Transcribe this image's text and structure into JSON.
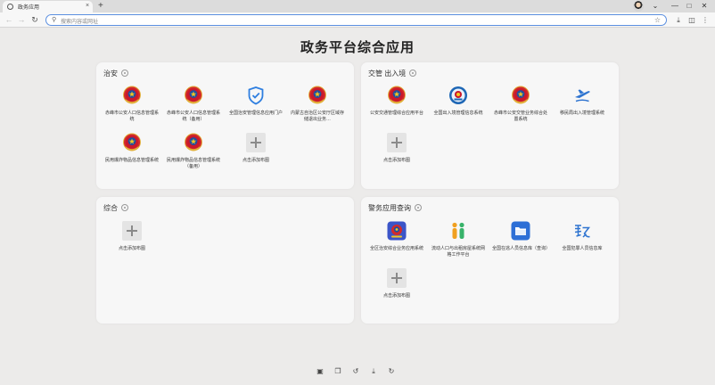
{
  "browser": {
    "tab_title": "政务应用",
    "new_tab": "+",
    "tab_close": "×",
    "window_controls": {
      "menu": "⌄",
      "minimize": "—",
      "maximize": "□",
      "close": "✕"
    },
    "address_placeholder": "搜索内容或网址",
    "icons": [
      "back-icon",
      "forward-icon",
      "reload-icon",
      "search-icon",
      "star-icon",
      "download-icon",
      "sidebar-icon",
      "menu-icon"
    ]
  },
  "page": {
    "title": "政务平台综合应用",
    "add_label": "点击添加布图"
  },
  "cards": {
    "zhian": {
      "title": "治安",
      "apps": [
        {
          "label": "赤峰市公安人口信息管理系统",
          "icon": "police-emblem-icon"
        },
        {
          "label": "赤峰市公安人口信息管理系统（备用）",
          "icon": "police-emblem-icon"
        },
        {
          "label": "全国治安管理信息应用门户",
          "icon": "shield-check-icon"
        },
        {
          "label": "内蒙古自治区公安厅区域存储退出业务…",
          "icon": "police-emblem-icon"
        },
        {
          "label": "民用爆炸物品信息管理系统",
          "icon": "police-emblem-icon"
        },
        {
          "label": "民用爆炸物品信息管理系统（备用）",
          "icon": "police-emblem-icon"
        }
      ]
    },
    "jiaoguan": {
      "title": "交管 出入境",
      "apps": [
        {
          "label": "公安交通管理综合应用平台",
          "icon": "police-emblem-icon"
        },
        {
          "label": "全国出入境管理信息系统",
          "icon": "immigration-badge-icon"
        },
        {
          "label": "赤峰市公安交管业务综合处置系统",
          "icon": "police-emblem-icon"
        },
        {
          "label": "移民局出入境管理系统",
          "icon": "plane-icon"
        }
      ]
    },
    "zonghe": {
      "title": "综合",
      "apps": []
    },
    "jingwu": {
      "title": "警务应用查询",
      "apps": [
        {
          "label": "全区治安综合业务应用系统",
          "icon": "police-app-icon"
        },
        {
          "label": "流动人口与出租房屋系统网格工作平台",
          "icon": "people-icon"
        },
        {
          "label": "全国在逃人员信息库（查询）",
          "icon": "folder-icon"
        },
        {
          "label": "全国犯罪人员信息库",
          "icon": "criminal-record-icon"
        }
      ]
    }
  },
  "bottom_bar": [
    "screenshot-icon",
    "copy-icon",
    "history-icon",
    "download-icon",
    "refresh-icon"
  ],
  "colors": {
    "address_border": "#5b8fe0",
    "card_bg": "#f7f7f7",
    "page_bg": "#ecebea"
  }
}
